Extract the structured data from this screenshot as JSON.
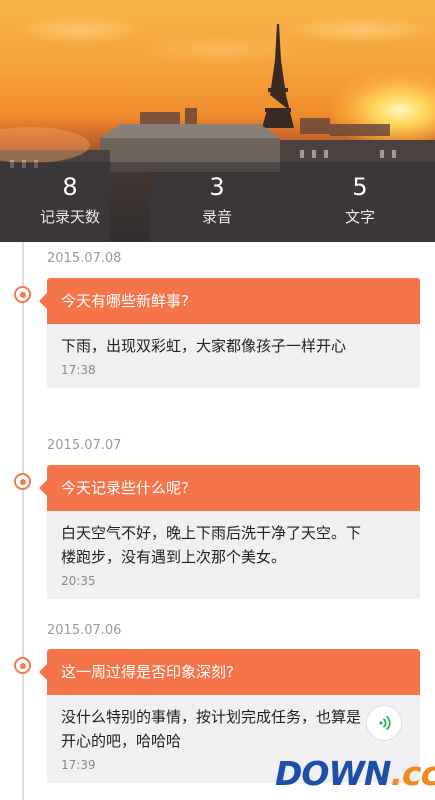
{
  "header": {
    "stats": [
      {
        "value": "8",
        "label": "记录天数"
      },
      {
        "value": "3",
        "label": "录音"
      },
      {
        "value": "5",
        "label": "文字"
      }
    ]
  },
  "entries": [
    {
      "date": "2015.07.08",
      "title": "今天有哪些新鲜事?",
      "text": "下雨，出现双彩虹，大家都像孩子一样开心",
      "time": "17:38",
      "has_audio": false
    },
    {
      "date": "2015.07.07",
      "title": "今天记录些什么呢?",
      "text": "白天空气不好，晚上下雨后洗干净了天空。下楼跑步，没有遇到上次那个美女。",
      "time": "20:35",
      "has_audio": false
    },
    {
      "date": "2015.07.06",
      "title": "这一周过得是否印象深刻?",
      "text": "没什么特别的事情，按计划完成任务，也算是开心的吧，哈哈哈",
      "time": "17:39",
      "has_audio": true,
      "audio_icon": "audio-wave-icon"
    }
  ],
  "watermark": {
    "main": "DOWN",
    "suffix": ".cc"
  },
  "colors": {
    "accent": "#f5744a",
    "card_bg": "#f0f0f2",
    "date_text": "#9a9a9a",
    "audio_icon": "#2fb34a"
  }
}
